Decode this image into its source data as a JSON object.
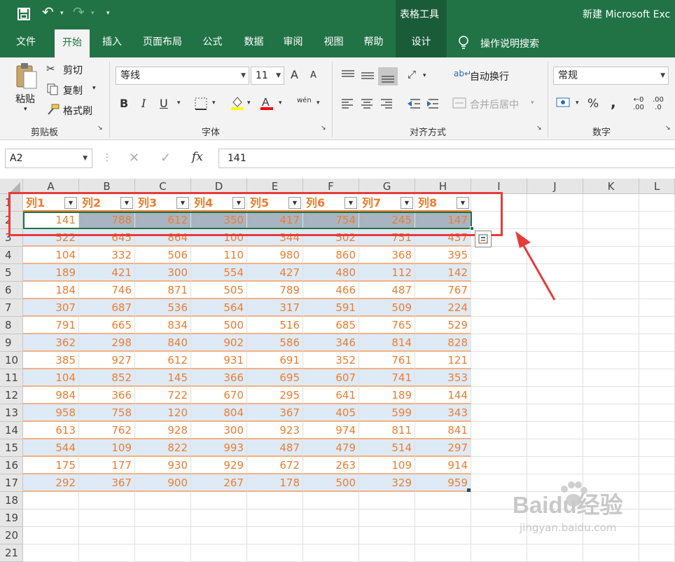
{
  "titlebar": {
    "title": "新建 Microsoft Exc",
    "tool_tab": "表格工具",
    "undo": "↶",
    "redo": "↷",
    "qa_more": "▾"
  },
  "tabs": [
    "文件",
    "开始",
    "插入",
    "页面布局",
    "公式",
    "数据",
    "审阅",
    "视图",
    "帮助",
    "设计"
  ],
  "active_tab": "开始",
  "search": "操作说明搜索",
  "ribbon": {
    "clipboard": {
      "paste": "粘贴",
      "cut": "剪切",
      "copy": "复制",
      "painter": "格式刷",
      "label": "剪贴板"
    },
    "font": {
      "name": "等线",
      "size": "11",
      "label": "字体",
      "bold": "B",
      "italic": "I",
      "underline": "U",
      "grow": "A",
      "shrink": "A",
      "phonetic": "wén"
    },
    "align": {
      "wrap": "自动换行",
      "merge": "合并后居中",
      "label": "对齐方式"
    },
    "number": {
      "format": "常规",
      "percent": "%",
      "comma": ",",
      "inc": ".00",
      "dec": ".0",
      "label": "数字"
    }
  },
  "formula": {
    "namebox": "A2",
    "value": "141",
    "fx": "fx"
  },
  "columns": [
    "A",
    "B",
    "C",
    "D",
    "E",
    "F",
    "G",
    "H",
    "I",
    "J",
    "K",
    "L"
  ],
  "rows": [
    "1",
    "2",
    "3",
    "4",
    "5",
    "6",
    "7",
    "8",
    "9",
    "10",
    "11",
    "12",
    "13",
    "14",
    "15",
    "16",
    "17",
    "18",
    "19",
    "20",
    "21"
  ],
  "headers": [
    "列1",
    "列2",
    "列3",
    "列4",
    "列5",
    "列6",
    "列7",
    "列8"
  ],
  "table": [
    [
      "141",
      "788",
      "612",
      "350",
      "417",
      "754",
      "245",
      "147"
    ],
    [
      "522",
      "645",
      "864",
      "100",
      "344",
      "502",
      "751",
      "437"
    ],
    [
      "104",
      "332",
      "506",
      "110",
      "980",
      "860",
      "368",
      "395"
    ],
    [
      "189",
      "421",
      "300",
      "554",
      "427",
      "480",
      "112",
      "142"
    ],
    [
      "184",
      "746",
      "871",
      "505",
      "789",
      "466",
      "487",
      "767"
    ],
    [
      "307",
      "687",
      "536",
      "564",
      "317",
      "591",
      "509",
      "224"
    ],
    [
      "791",
      "665",
      "834",
      "500",
      "516",
      "685",
      "765",
      "529"
    ],
    [
      "362",
      "298",
      "840",
      "902",
      "586",
      "346",
      "814",
      "828"
    ],
    [
      "385",
      "927",
      "612",
      "931",
      "691",
      "352",
      "761",
      "121"
    ],
    [
      "104",
      "852",
      "145",
      "366",
      "695",
      "607",
      "741",
      "353"
    ],
    [
      "984",
      "366",
      "722",
      "670",
      "295",
      "641",
      "189",
      "144"
    ],
    [
      "958",
      "758",
      "120",
      "804",
      "367",
      "405",
      "599",
      "343"
    ],
    [
      "613",
      "762",
      "928",
      "300",
      "923",
      "974",
      "811",
      "841"
    ],
    [
      "544",
      "109",
      "822",
      "993",
      "487",
      "479",
      "514",
      "297"
    ],
    [
      "175",
      "177",
      "930",
      "929",
      "672",
      "263",
      "109",
      "914"
    ],
    [
      "292",
      "367",
      "900",
      "267",
      "178",
      "500",
      "329",
      "959"
    ]
  ],
  "colors": {
    "excel_green": "#217346",
    "table_orange": "#ed7d31",
    "band_blue": "#deeaf6",
    "annotation_red": "#e63b3b"
  },
  "watermark": {
    "brand": "Baidu经验",
    "url": "jingyan.baidu.com"
  }
}
